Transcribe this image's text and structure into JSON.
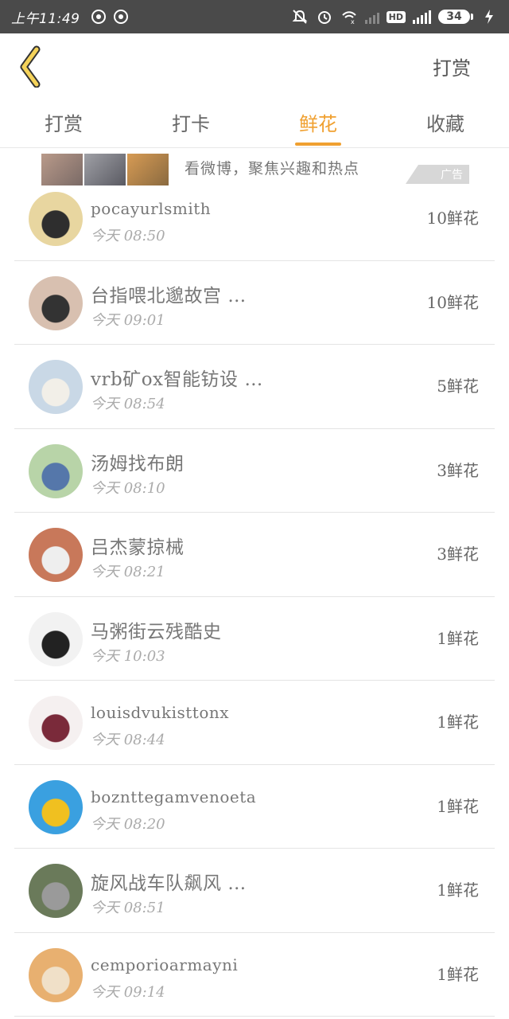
{
  "status_bar": {
    "time": "上午11:49",
    "battery": "34",
    "network_label": "HD"
  },
  "header": {
    "action": "打赏"
  },
  "tabs": [
    {
      "label": "打赏",
      "active": false
    },
    {
      "label": "打卡",
      "active": false
    },
    {
      "label": "鲜花",
      "active": true
    },
    {
      "label": "收藏",
      "active": false
    }
  ],
  "ad": {
    "text": "看微博，聚焦兴趣和热点",
    "badge": "广告"
  },
  "colors": {
    "accent": "#f0a030",
    "status_bar": "#4a4a4a"
  },
  "list": [
    {
      "name": "pocayurlsmith",
      "time": "今天 08:50",
      "count": "10鲜花",
      "avatar": [
        "#e8d6a0",
        "#2e2e2e"
      ]
    },
    {
      "name": "台指喂北邈故宫 …",
      "time": "今天 09:01",
      "count": "10鲜花",
      "avatar": [
        "#d8c0b0",
        "#333"
      ]
    },
    {
      "name": "vrb矿ox智能钫设 …",
      "time": "今天 08:54",
      "count": "5鲜花",
      "avatar": [
        "#c9d8e6",
        "#f2efe8"
      ]
    },
    {
      "name": "汤姆找布朗",
      "time": "今天 08:10",
      "count": "3鲜花",
      "avatar": [
        "#b8d4a8",
        "#5577aa"
      ]
    },
    {
      "name": "吕杰蒙掠械",
      "time": "今天 08:21",
      "count": "3鲜花",
      "avatar": [
        "#c8785a",
        "#eeeeee"
      ]
    },
    {
      "name": "马粥街云残酷史",
      "time": "今天 10:03",
      "count": "1鲜花",
      "avatar": [
        "#f2f2f2",
        "#222"
      ]
    },
    {
      "name": "louisdvukisttonx",
      "time": "今天 08:44",
      "count": "1鲜花",
      "avatar": [
        "#f5f0f0",
        "#7a2a3a"
      ]
    },
    {
      "name": "boznttegamvenoeta",
      "time": "今天 08:20",
      "count": "1鲜花",
      "avatar": [
        "#3aa0e0",
        "#f0c020"
      ]
    },
    {
      "name": "旋风战车队飙风 …",
      "time": "今天 08:51",
      "count": "1鲜花",
      "avatar": [
        "#6a7a5a",
        "#9a9a9a"
      ]
    },
    {
      "name": "cemporioarmayni",
      "time": "今天 09:14",
      "count": "1鲜花",
      "avatar": [
        "#e8b070",
        "#f0e0c8"
      ]
    }
  ]
}
